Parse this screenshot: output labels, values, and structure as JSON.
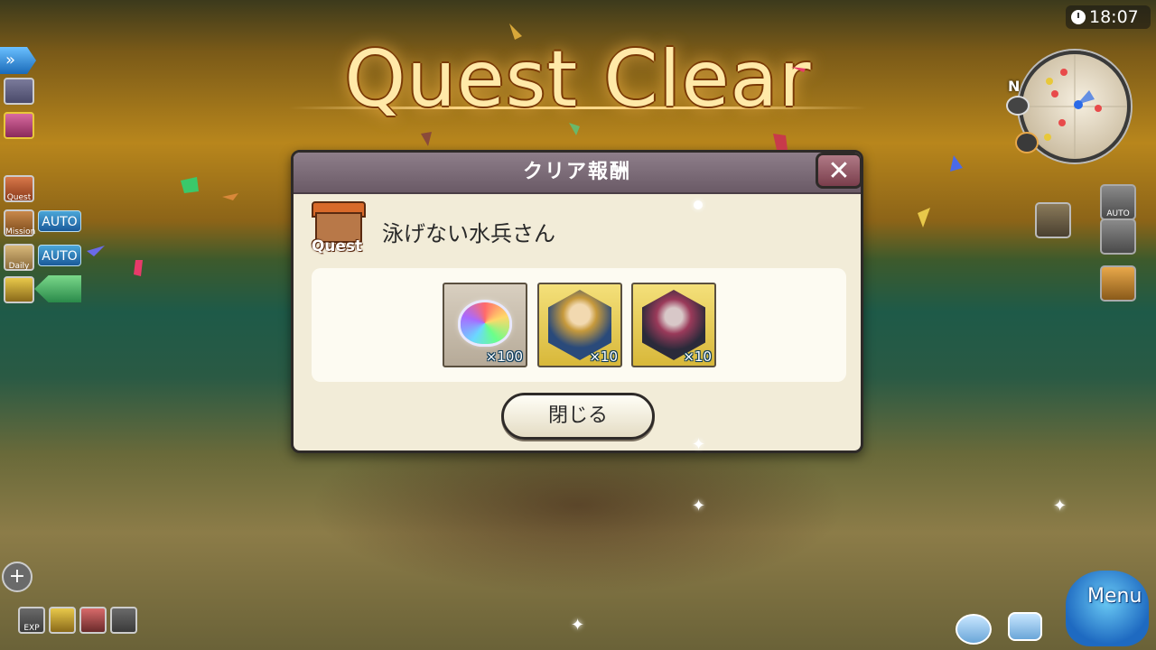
{
  "title": "Quest Clear",
  "clock": "18:07",
  "minimap": {
    "north_label": "N"
  },
  "sidebar": {
    "quest_label": "Quest",
    "mission_label": "Mission",
    "daily_label": "Daily",
    "auto_label": "AUTO"
  },
  "dialog": {
    "header": "クリア報酬",
    "quest_badge": "Quest",
    "quest_name": "泳げない水兵さん",
    "rewards": [
      {
        "icon": "rainbow-crystal-icon",
        "qty": "×100"
      },
      {
        "icon": "blonde-hero-portrait-icon",
        "qty": "×10"
      },
      {
        "icon": "masked-warrior-portrait-icon",
        "qty": "×10"
      }
    ],
    "close_button": "閉じる",
    "close_icon": "✕"
  },
  "right_panel": {
    "auto_label": "AUTO"
  },
  "bottom_left": {
    "exp_label": "EXP"
  },
  "menu_label": "Menu",
  "colors": {
    "header": "#7a6a76",
    "dialog_bg": "#f2ecd8",
    "title_glow": "#ffd98a"
  }
}
